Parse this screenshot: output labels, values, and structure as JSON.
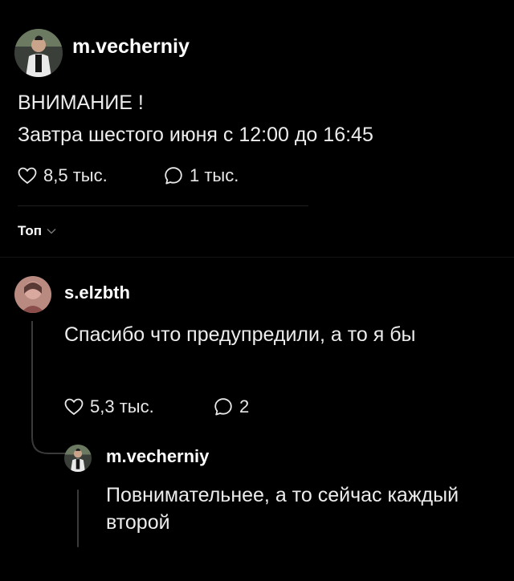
{
  "post": {
    "username": "m.vecherniy",
    "line1": "ВНИМАНИЕ !",
    "line2": "Завтра шестого июня с 12:00 до 16:45",
    "likes": "8,5 тыс.",
    "comments": "1 тыс."
  },
  "sort": {
    "label": "Топ"
  },
  "comment": {
    "username": "s.elzbth",
    "text": "Спасибо что предупредили, а то я бы",
    "likes": "5,3 тыс.",
    "replies": "2"
  },
  "reply": {
    "username": "m.vecherniy",
    "text": "Повнимательнее, а то сейчас каждый второй"
  },
  "colors": {
    "background": "#000000",
    "text": "#f2f2f2",
    "line": "#3a3a3a"
  },
  "icons": [
    "heart-icon",
    "comment-bubble-icon",
    "chevron-down-icon"
  ]
}
